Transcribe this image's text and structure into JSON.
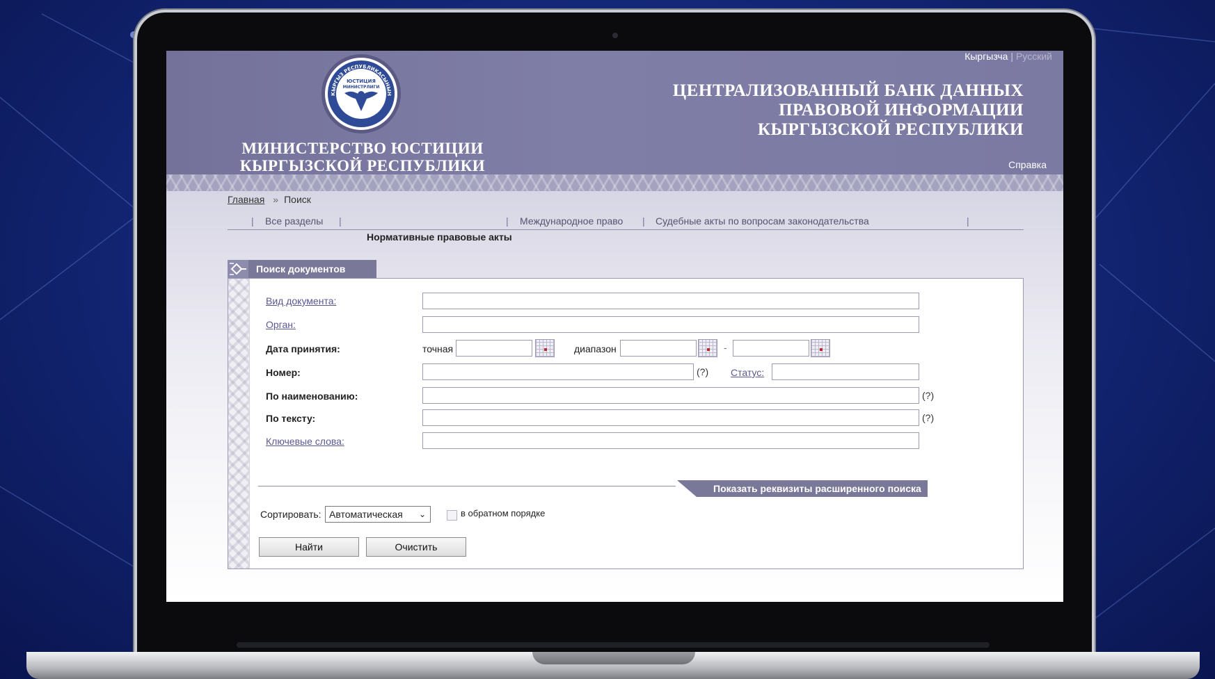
{
  "header": {
    "lang": {
      "kyrgyz": "Кыргызча",
      "separator": "|",
      "russian": "Русский"
    },
    "ministry": [
      "МИНИСТЕРСТВО ЮСТИЦИИ",
      "КЫРГЫЗСКОЙ РЕСПУБЛИКИ"
    ],
    "bank_title": [
      "ЦЕНТРАЛИЗОВАННЫЙ БАНК ДАННЫХ",
      "ПРАВОВОЙ ИНФОРМАЦИИ",
      "КЫРГЫЗСКОЙ РЕСПУБЛИКИ"
    ],
    "help": "Справка",
    "emblem": {
      "top_text": "КЫРГЫЗ РЕСПУБЛИКАСЫНЫН",
      "center_text": [
        "ЮСТИЦИЯ",
        "МИНИСТРЛИГИ"
      ]
    }
  },
  "breadcrumb": {
    "home": "Главная",
    "separator": "»",
    "current": "Поиск"
  },
  "tabs": {
    "all": "Все разделы",
    "international": "Международное право",
    "court": "Судебные акты по вопросам законодательства",
    "active_sub": "Нормативные правовые акты",
    "pipe": "|"
  },
  "search_panel": {
    "title": "Поиск документов",
    "fields": {
      "doc_type": {
        "label": "Вид документа:",
        "value": ""
      },
      "organ": {
        "label": "Орган:",
        "value": ""
      },
      "adoption_date": {
        "label": "Дата принятия:",
        "exact": "точная",
        "range": "диапазон",
        "dash": "-"
      },
      "number": {
        "label": "Номер:",
        "help": "(?)"
      },
      "status": {
        "label": "Статус:"
      },
      "by_name": {
        "label": "По наименованию:",
        "help": "(?)"
      },
      "by_text": {
        "label": "По тексту:",
        "help": "(?)"
      },
      "keywords": {
        "label": "Ключевые слова:"
      }
    },
    "advanced_toggle": "Показать реквизиты расширенного поиска",
    "sort": {
      "label": "Сортировать:",
      "selected": "Автоматическая",
      "reverse_label": "в обратном порядке",
      "reverse_checked": false
    },
    "buttons": {
      "find": "Найти",
      "clear": "Очистить"
    }
  },
  "colors": {
    "header": "#7b7aa2",
    "accent": "#7a7899",
    "link": "#5a5890",
    "background": "#14287a"
  }
}
